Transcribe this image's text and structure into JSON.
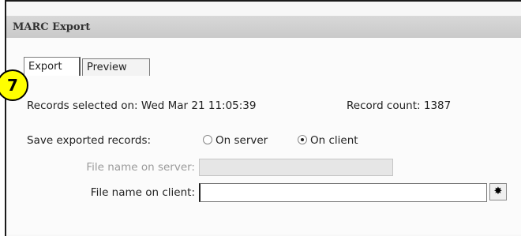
{
  "window": {
    "title": "MARC Export"
  },
  "tabs": [
    {
      "label": "Export"
    },
    {
      "label": "Preview"
    }
  ],
  "badge": {
    "number": "7",
    "color": "#ffff00"
  },
  "records": {
    "selected_text": "Records selected on: Wed Mar 21 11:05:39",
    "count_text": "Record count: 1387"
  },
  "save": {
    "label": "Save exported records:",
    "options": [
      {
        "label": "On server",
        "checked": false
      },
      {
        "label": "On client",
        "checked": true
      }
    ]
  },
  "fields": {
    "server_label": "File name on server:",
    "server_value": "",
    "client_label": "File name on client:",
    "client_value": ""
  },
  "icons": {
    "browse": "compass-browse-icon"
  }
}
